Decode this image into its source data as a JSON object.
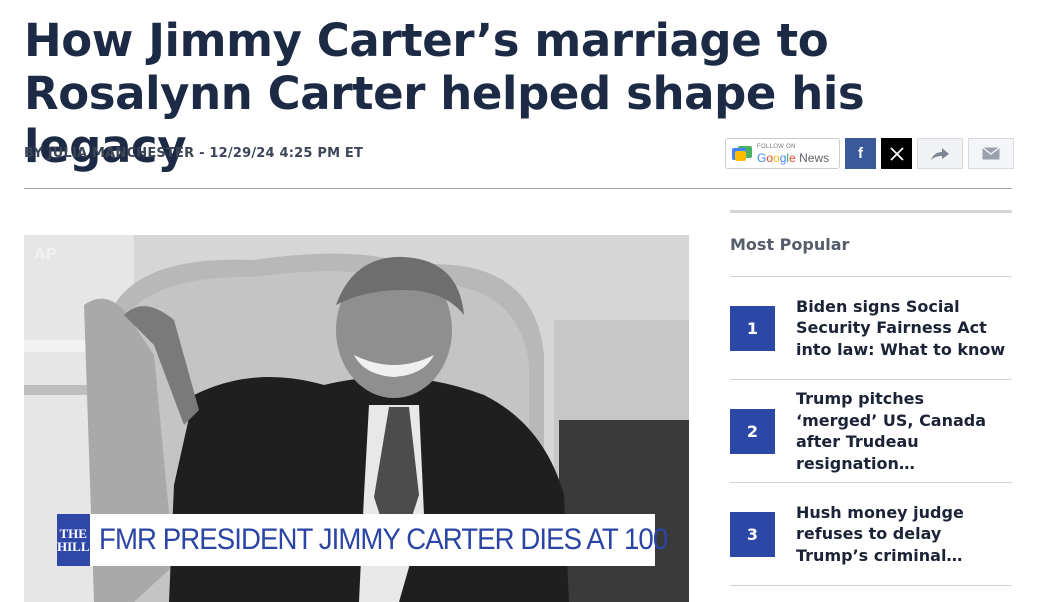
{
  "article": {
    "headline": "How Jimmy Carter’s marriage to Rosalynn Carter helped shape his legacy",
    "byline": "BY JULIA MANCHESTER - 12/29/24 4:25 PM ET"
  },
  "share": {
    "google_news_small": "FOLLOW ON",
    "google_news_label": "Google News",
    "facebook_glyph": "f",
    "icons": [
      "google-news-icon",
      "facebook-icon",
      "x-icon",
      "share-forward-icon",
      "email-icon"
    ]
  },
  "photo": {
    "credit": "AP",
    "logo_line1": "THE",
    "logo_line2": "HILL",
    "lower_third": "FMR PRESIDENT JIMMY CARTER DIES AT 100"
  },
  "sidebar": {
    "title": "Most Popular",
    "items": [
      {
        "rank": "1",
        "text": "Biden signs Social Security Fairness Act into law: What to know"
      },
      {
        "rank": "2",
        "text": "Trump pitches ‘merged’ US, Canada after Trudeau resignation…"
      },
      {
        "rank": "3",
        "text": "Hush money judge refuses to delay Trump’s criminal…"
      }
    ]
  },
  "colors": {
    "headline": "#1c2a45",
    "accent_blue": "#2b48a6",
    "facebook": "#3b5998"
  }
}
